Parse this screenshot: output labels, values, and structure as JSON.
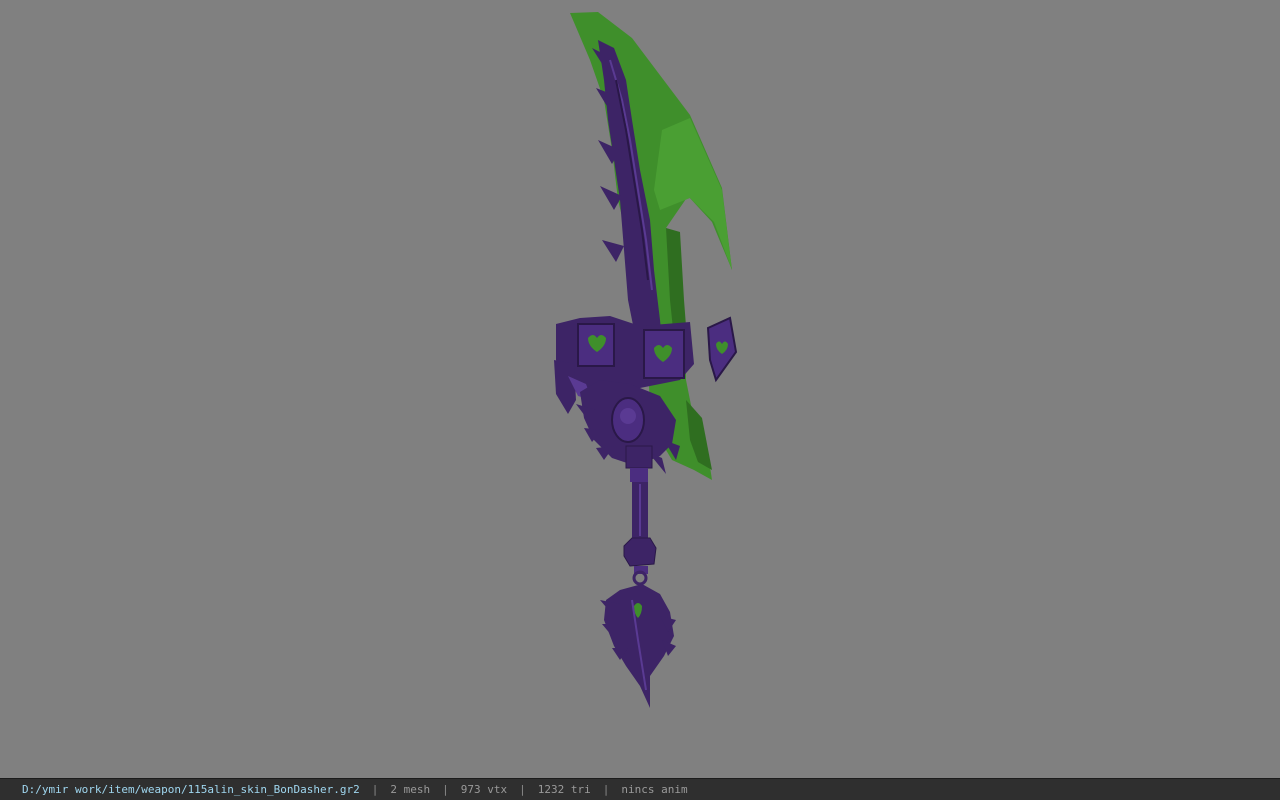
{
  "viewer": {
    "background_color": "#808080",
    "model_colors": {
      "blade_green": "#3f8f2b",
      "blade_green_dark": "#2f6e20",
      "ornament_purple": "#3d2466",
      "ornament_purple_light": "#5a3a93"
    }
  },
  "status_bar": {
    "file_path": "D:/ymir work/item/weapon/115alin_skin_BonDasher.gr2",
    "separator": "|",
    "mesh_count": "2 mesh",
    "vertex_count": "973 vtx",
    "triangle_count": "1232 tri",
    "animation": "nincs anim"
  }
}
